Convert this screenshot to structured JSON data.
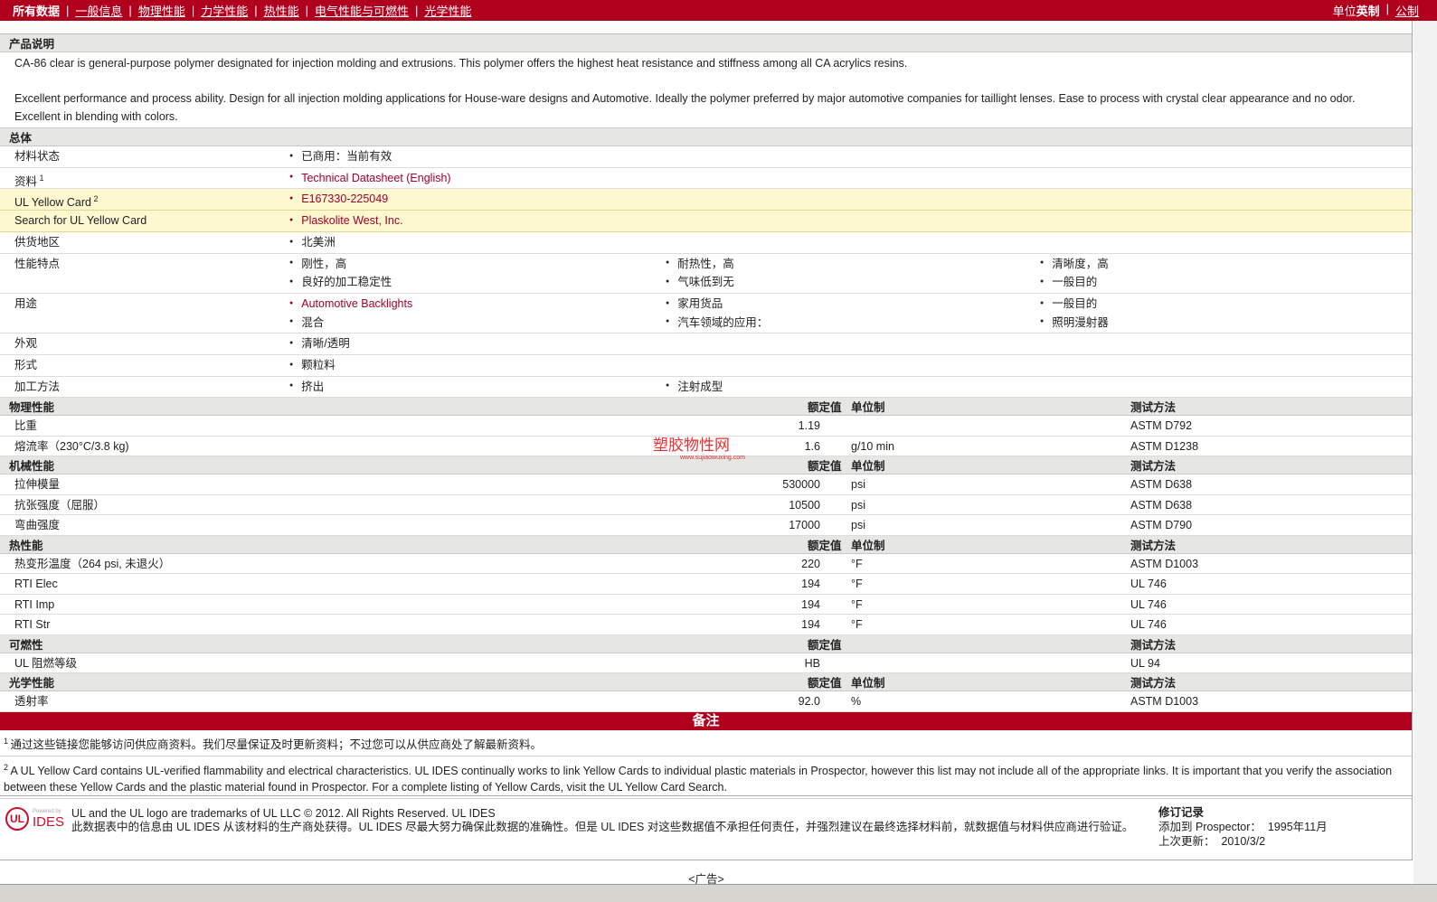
{
  "nav": {
    "items": [
      "所有数据",
      "一般信息",
      "物理性能",
      "力学性能",
      "热性能",
      "电气性能与可燃性",
      "光学性能"
    ],
    "unit_label": "单位",
    "units": [
      "英制",
      "公制"
    ]
  },
  "product_desc": {
    "title": "产品说明",
    "paragraphs": [
      "CA-86 clear is general-purpose polymer designated for injection molding and extrusions. This polymer offers the highest heat resistance and stiffness among all CA acrylics resins.",
      "Excellent performance and process ability. Design for all injection molding applications for House-ware designs and Automotive. Ideally the polymer preferred by major automotive companies for taillight lenses. Ease to process with crystal clear appearance and no odor. Excellent in blending with colors."
    ]
  },
  "general": {
    "title": "总体",
    "rows": [
      {
        "label": "材料状态",
        "items": [
          "已商用：当前有效"
        ]
      },
      {
        "label": "资料",
        "sup": "1",
        "items": [
          "Technical Datasheet (English)"
        ],
        "link": true
      },
      {
        "label": "UL Yellow Card",
        "sup": "2",
        "items": [
          "E167330-225049"
        ],
        "link": true,
        "yellow": true
      },
      {
        "label": "Search for UL Yellow Card",
        "items": [
          "Plaskolite West, Inc."
        ],
        "link": true,
        "yellow": true
      },
      {
        "label": "供货地区",
        "items": [
          "北美洲"
        ]
      },
      {
        "label": "性能特点",
        "items": [
          "刚性，高",
          "耐热性，高",
          "清晰度，高",
          "良好的加工稳定性",
          "气味低到无",
          "一般目的"
        ]
      },
      {
        "label": "用途",
        "items": [
          "Automotive Backlights",
          "家用货品",
          "一般目的",
          "混合",
          "汽车领域的应用：",
          "照明漫射器"
        ],
        "link_first": true
      },
      {
        "label": "外观",
        "items": [
          "清晰/透明"
        ]
      },
      {
        "label": "形式",
        "items": [
          "颗粒料"
        ]
      },
      {
        "label": "加工方法",
        "items": [
          "挤出",
          "注射成型"
        ]
      }
    ]
  },
  "sections": [
    {
      "title": "物理性能",
      "h_value": "额定值",
      "h_unit": "单位制",
      "h_test": "测试方法",
      "rows": [
        [
          "比重",
          "1.19",
          "",
          "ASTM D792"
        ],
        [
          "熔流率（230°C/3.8 kg)",
          "1.6",
          "g/10 min",
          "ASTM D1238"
        ]
      ]
    },
    {
      "title": "机械性能",
      "h_value": "额定值",
      "h_unit": "单位制",
      "h_test": "测试方法",
      "rows": [
        [
          "拉伸模量",
          "530000",
          "psi",
          "ASTM D638"
        ],
        [
          "抗张强度（屈服）",
          "10500",
          "psi",
          "ASTM D638"
        ],
        [
          "弯曲强度",
          "17000",
          "psi",
          "ASTM D790"
        ]
      ]
    },
    {
      "title": "热性能",
      "h_value": "额定值",
      "h_unit": "单位制",
      "h_test": "测试方法",
      "rows": [
        [
          "热变形温度（264 psi, 未退火）",
          "220",
          "°F",
          "ASTM D1003"
        ],
        [
          "RTI Elec",
          "194",
          "°F",
          "UL 746"
        ],
        [
          "RTI Imp",
          "194",
          "°F",
          "UL 746"
        ],
        [
          "RTI Str",
          "194",
          "°F",
          "UL 746"
        ]
      ]
    },
    {
      "title": "可燃性",
      "h_value": "额定值",
      "h_unit": "",
      "h_test": "测试方法",
      "rows": [
        [
          "UL 阻燃等级",
          "HB",
          "",
          "UL 94"
        ]
      ]
    },
    {
      "title": "光学性能",
      "h_value": "额定值",
      "h_unit": "单位制",
      "h_test": "测试方法",
      "rows": [
        [
          "透射率",
          "92.0",
          "%",
          "ASTM D1003"
        ]
      ]
    }
  ],
  "watermark": {
    "text": "塑胶物性网",
    "url": "www.sujiaowuxing.com"
  },
  "notes": {
    "title": "备注",
    "footnotes": [
      {
        "num": "1",
        "text": "通过这些链接您能够访问供应商资料。我们尽量保证及时更新资料；不过您可以从供应商处了解最新资料。"
      },
      {
        "num": "2",
        "text": "A UL Yellow Card contains UL-verified flammability and electrical characteristics. UL IDES continually works to link Yellow Cards to individual plastic materials in Prospector, however this list may not include all of the appropriate links. It is important that you verify the association between these Yellow Cards and the plastic material found in Prospector. For a complete listing of Yellow Cards, visit the UL Yellow Card Search."
      }
    ]
  },
  "footer": {
    "logo_text": "UL",
    "powered": "Powered by",
    "ides": "IDES",
    "line1": "UL and the UL logo are trademarks of UL LLC © 2012. All Rights Reserved. UL IDES",
    "line2": "此数据表中的信息由  UL IDES 从该材料的生产商处获得。UL IDES 尽最大努力确保此数据的准确性。但是  UL IDES 对这些数据值不承担任何责任，并强烈建议在最终选择材料前，就数据值与材料供应商进行验证。",
    "rev_title": "修订记录",
    "added_label": "添加到 Prospector：",
    "added": "1995年11月",
    "updated_label": "上次更新：",
    "updated": "2010/3/2"
  },
  "ad": "<广告>",
  "colors": {
    "brand_red": "#b0001e",
    "link": "#a0002a",
    "yellow": "#fdf8d0"
  }
}
